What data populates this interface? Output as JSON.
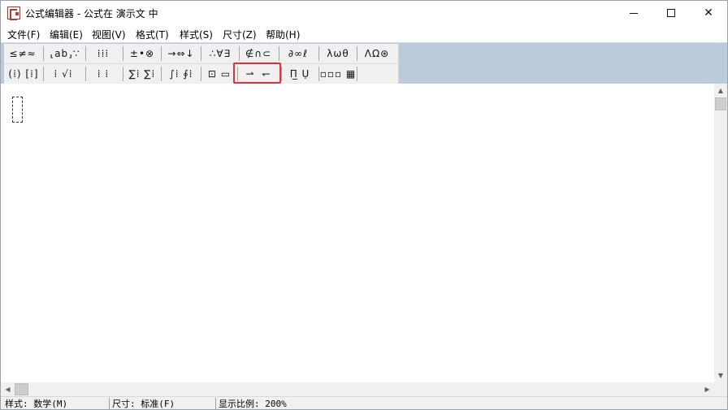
{
  "window": {
    "title": "公式编辑器 - 公式在 演示文 中",
    "controls": {
      "minimize": "minimize",
      "maximize": "maximize",
      "close": "✕"
    }
  },
  "menu": [
    "文件(F)",
    "编辑(E)",
    "视图(V)",
    "格式(T)",
    "样式(S)",
    "尺寸(Z)",
    "帮助(H)"
  ],
  "toolbar": {
    "row1": [
      {
        "id": "relations",
        "label": "≤≠≈"
      },
      {
        "id": "spaces",
        "label": "⸤ab⸥∵"
      },
      {
        "id": "embellish",
        "label": "⁞⁞⁞"
      },
      {
        "id": "operators",
        "label": "±•⊗"
      },
      {
        "id": "arrows",
        "label": "→⇔↓"
      },
      {
        "id": "logic",
        "label": "∴∀∃"
      },
      {
        "id": "sets",
        "label": "∉∩⊂"
      },
      {
        "id": "misc",
        "label": "∂∞ℓ"
      },
      {
        "id": "greek-lower",
        "label": "λωθ"
      },
      {
        "id": "greek-upper",
        "label": "ΛΩ⊛"
      }
    ],
    "row2": [
      {
        "id": "fences",
        "label": "(⁞) [⁞]"
      },
      {
        "id": "fractions",
        "label": "⁞ √⁞"
      },
      {
        "id": "scripts",
        "label": "⁞ ⁞"
      },
      {
        "id": "sums",
        "label": "∑⁞ ∑⁞"
      },
      {
        "id": "integrals",
        "label": "∫⁞ ∮⁞"
      },
      {
        "id": "bars",
        "label": "⊡ ▭"
      },
      {
        "id": "labeled-arrows",
        "label": "⇀ ↽"
      },
      {
        "id": "products",
        "label": "Π̲ Ụ"
      },
      {
        "id": "matrices",
        "label": "▫▫▫ ▦"
      }
    ]
  },
  "statusbar": {
    "style": "样式: 数学(M)",
    "size": "尺寸: 标准(F)",
    "zoom": "显示比例: 200%"
  }
}
